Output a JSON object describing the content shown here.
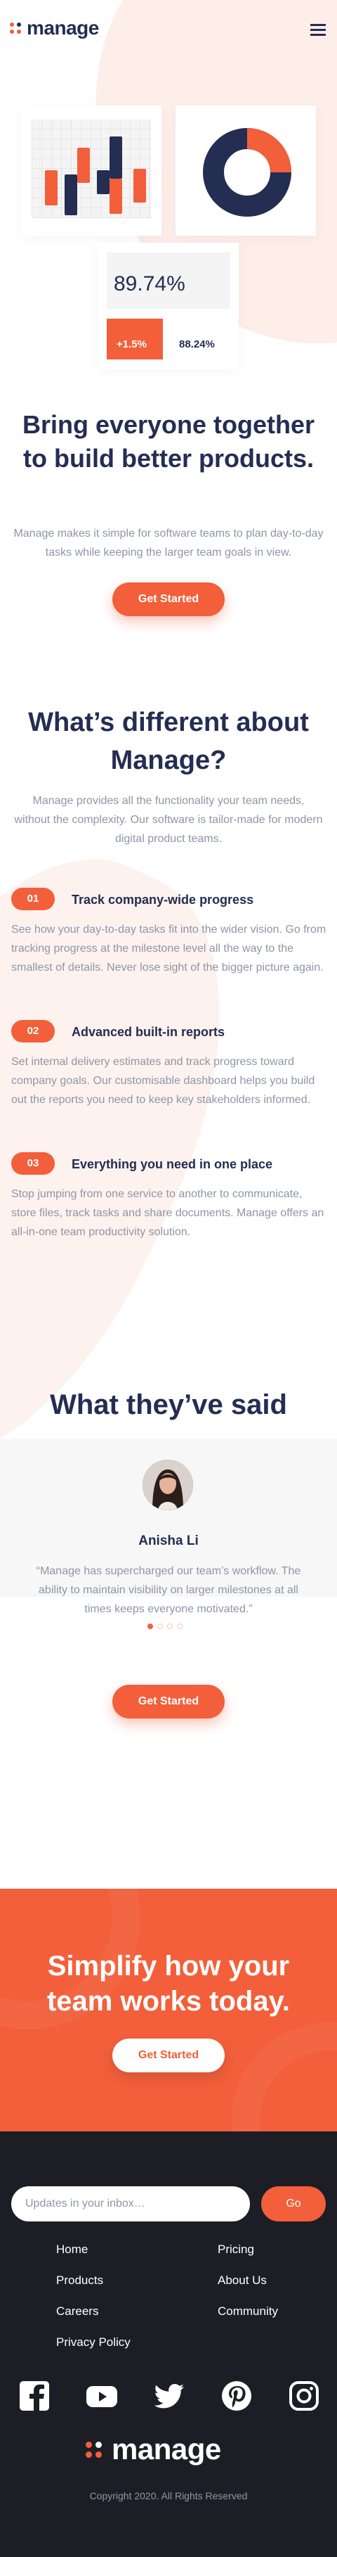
{
  "header": {
    "logo_text": "manage"
  },
  "illustration": {
    "percent_value": "89.74%",
    "growth_badge": "+1.5%",
    "secondary_value": "88.24%",
    "colors": {
      "accent": "#f25f3a",
      "dark": "#242d52"
    }
  },
  "hero": {
    "title": "Bring everyone together to build better products.",
    "description": "Manage makes it simple for software teams to plan day-to-day tasks while keeping the larger team goals in view.",
    "cta_label": "Get Started"
  },
  "different": {
    "title": "What’s different about Manage?",
    "description": "Manage provides all the functionality your team needs, without the complexity. Our software is tailor-made for modern digital product teams.",
    "features": [
      {
        "number": "01",
        "title": "Track company-wide progress",
        "description": "See how your day-to-day tasks fit into the wider vision. Go from tracking progress at the milestone level all the way to the smallest of details. Never lose sight of the bigger picture again."
      },
      {
        "number": "02",
        "title": "Advanced built-in reports",
        "description": "Set internal delivery estimates and track progress toward company goals. Our customisable dashboard helps you build out the reports you need to keep key stakeholders informed."
      },
      {
        "number": "03",
        "title": "Everything you need in one place",
        "description": "Stop jumping from one service to another to communicate, store files, track tasks and share documents. Manage offers an all-in-one team productivity solution."
      }
    ]
  },
  "testimonials": {
    "title": "What they’ve said",
    "name": "Anisha Li",
    "quote": "“Manage has supercharged our team’s workflow. The ability to maintain visibility on larger milestones at all times keeps everyone motivated.”",
    "active_slide": 1,
    "slide_count": 4,
    "cta_label": "Get Started"
  },
  "cta": {
    "title": "Simplify how your team works today.",
    "button_label": "Get Started"
  },
  "footer": {
    "newsletter_placeholder": "Updates in your inbox…",
    "go_label": "Go",
    "links": [
      "Home",
      "Pricing",
      "Products",
      "About Us",
      "Careers",
      "Community",
      "Privacy Policy"
    ],
    "logo_text": "manage",
    "copyright": "Copyright 2020. All Rights Reserved",
    "socials": [
      "facebook-icon",
      "youtube-icon",
      "twitter-icon",
      "pinterest-icon",
      "instagram-icon"
    ]
  }
}
